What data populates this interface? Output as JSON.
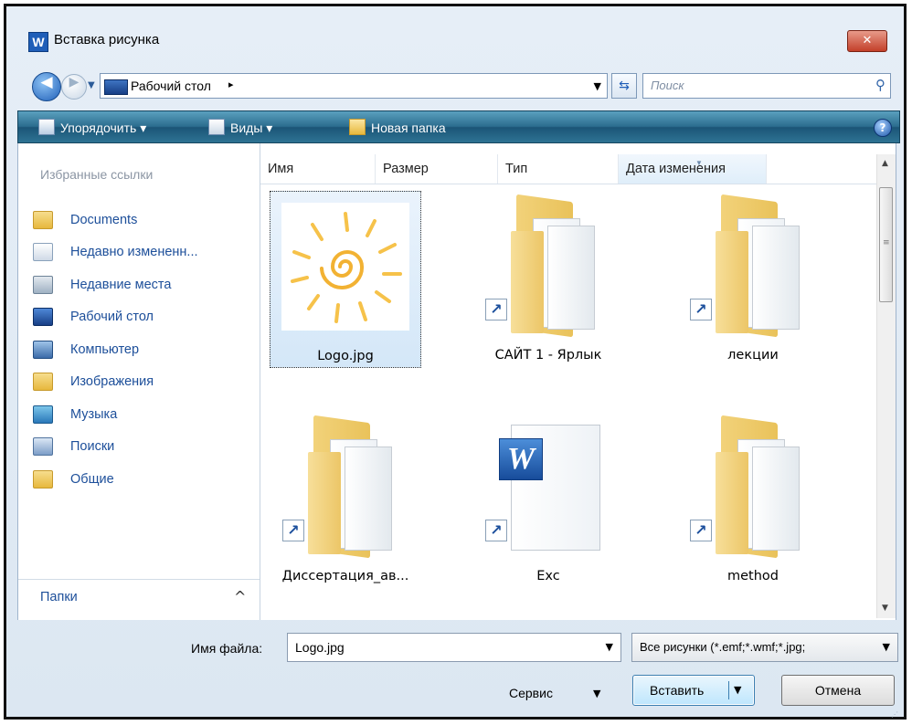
{
  "window": {
    "title": "Вставка рисунка",
    "app_icon": "W",
    "close_glyph": "✕"
  },
  "nav": {
    "back_glyph": "◀",
    "forward_glyph": "▶",
    "address_path": "Рабочий стол",
    "address_separator": "▸",
    "refresh_glyph": "⇆",
    "search_placeholder": "Поиск"
  },
  "toolbar": {
    "organize_label": "Упорядочить ▾",
    "views_label": "Виды ▾",
    "new_folder_label": "Новая папка",
    "help_glyph": "?"
  },
  "sidebar": {
    "favorites_title": "Избранные ссылки",
    "items": [
      {
        "label": "Documents",
        "icon": "folder-icon"
      },
      {
        "label": "Недавно измененн...",
        "icon": "recent-icon"
      },
      {
        "label": "Недавние места",
        "icon": "recent-places-icon"
      },
      {
        "label": "Рабочий стол",
        "icon": "desktop-icon"
      },
      {
        "label": "Компьютер",
        "icon": "computer-icon"
      },
      {
        "label": "Изображения",
        "icon": "folder-icon"
      },
      {
        "label": "Музыка",
        "icon": "music-icon"
      },
      {
        "label": "Поиски",
        "icon": "searches-icon"
      },
      {
        "label": "Общие",
        "icon": "folder-icon"
      }
    ],
    "folders_label": "Папки",
    "folders_chevron": "^"
  },
  "columns": {
    "name": "Имя",
    "size": "Размер",
    "type": "Тип",
    "modified": "Дата изменения"
  },
  "files": [
    {
      "label": "Logo.jpg",
      "kind": "image",
      "selected": true
    },
    {
      "label": "САЙТ 1 - Ярлык",
      "kind": "folder-shortcut"
    },
    {
      "label": "лекции",
      "kind": "folder-shortcut"
    },
    {
      "label": "Диссертация_ав...",
      "kind": "folder-shortcut"
    },
    {
      "label": "Exc",
      "kind": "word-shortcut"
    },
    {
      "label": "method",
      "kind": "folder-shortcut"
    }
  ],
  "bottom": {
    "filename_label": "Имя файла:",
    "filename_value": "Logo.jpg",
    "filter_value": "Все рисунки (*.emf;*.wmf;*.jpg;",
    "service_label": "Сервис",
    "insert_label": "Вставить",
    "cancel_label": "Отмена"
  },
  "colors": {
    "link_blue": "#1d4f9a",
    "toolbar_teal": "#2c6d8f",
    "close_red": "#c3402a",
    "folder_yellow": "#e9c25a"
  }
}
